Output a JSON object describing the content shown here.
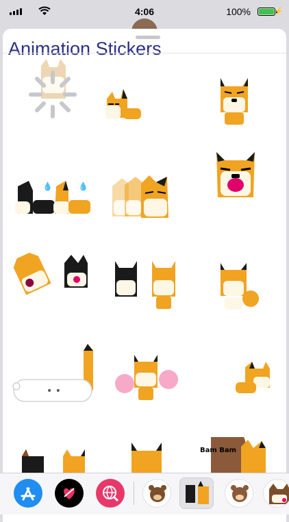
{
  "status": {
    "time": "4:06",
    "battery_pct": "100%",
    "battery_level": 1.0,
    "battery_color": "#39c64a"
  },
  "sheet": {
    "title": "Animation Stickers",
    "title_color": "#2b2f86"
  },
  "stickers": [
    {
      "name": "loading-sticker",
      "desc": "loading spinner over dog"
    },
    {
      "name": "sleeping-dog-sticker"
    },
    {
      "name": "sitting-dog-sticker"
    },
    {
      "name": "two-dogs-pushing-sticker"
    },
    {
      "name": "dog-animation-blur-sticker"
    },
    {
      "name": "yelling-dog-sticker"
    },
    {
      "name": "dog-kiss-sticker"
    },
    {
      "name": "two-dogs-standing-sticker"
    },
    {
      "name": "dog-wave-sticker"
    },
    {
      "name": "typing-bubble-sticker"
    },
    {
      "name": "cheerleader-dog-sticker"
    },
    {
      "name": "lying-dog-sticker"
    },
    {
      "name": "two-dogs-bottom-sticker"
    },
    {
      "name": "dog-ears-sticker"
    },
    {
      "name": "bam-bam-sticker"
    }
  ],
  "typing_dots": "• •",
  "bam_text": "Bam Bam",
  "toolbar": {
    "items": [
      {
        "name": "app-store-icon"
      },
      {
        "name": "digital-touch-icon"
      },
      {
        "name": "web-search-icon"
      },
      {
        "name": "sticker-pack-bear"
      },
      {
        "name": "sticker-pack-animation"
      },
      {
        "name": "sticker-pack-bear-2"
      },
      {
        "name": "sticker-pack-dog"
      }
    ]
  }
}
